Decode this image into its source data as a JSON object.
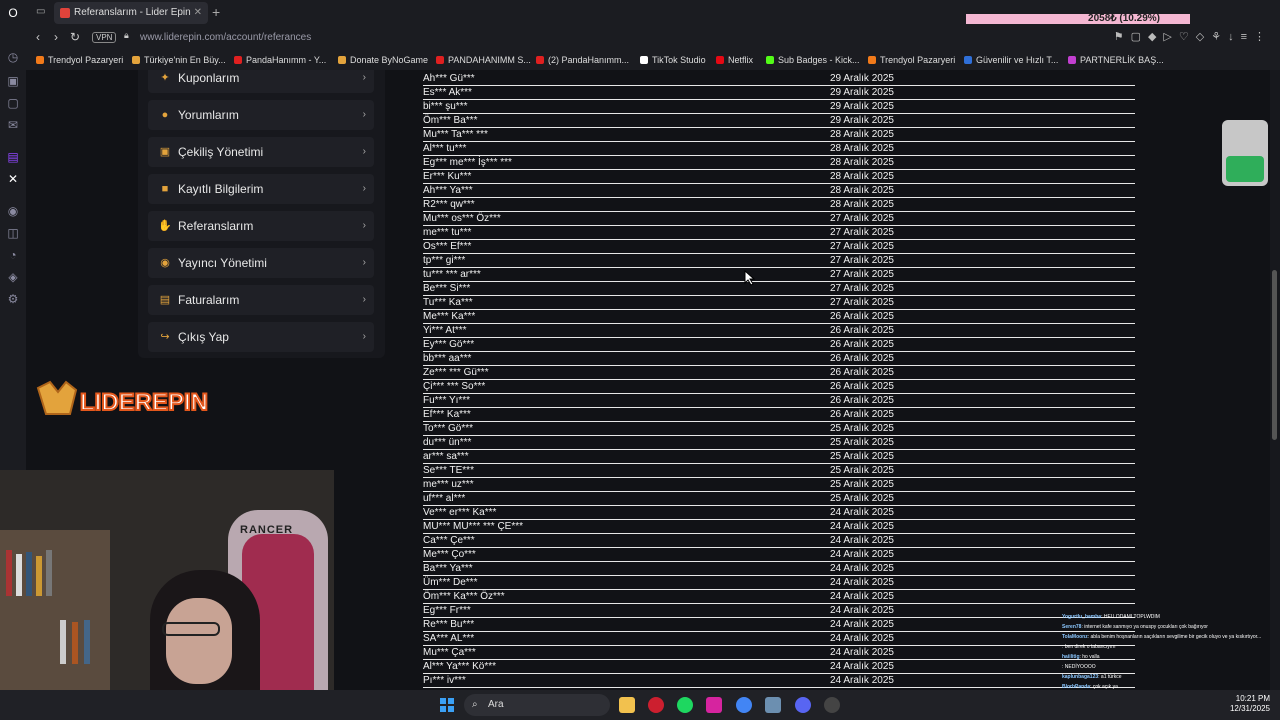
{
  "browser": {
    "tab_title": "Referanslarım - Lider Epin",
    "url": "www.liderepin.com/account/referances",
    "vpn_label": "VPN",
    "progress_text": "2058₺ (10.29%)",
    "progress_fraction": 0.1029
  },
  "bookmarks": [
    "Trendyol Pazaryeri",
    "Türkiye'nin En Büy...",
    "PandaHanımm - Y...",
    "Donate ByNoGame",
    "PANDAHANIMM S...",
    "(2) PandaHanımm...",
    "TikTok Studio",
    "Netflix",
    "Sub Badges - Kick...",
    "Trendyol Pazaryeri",
    "Güvenilir ve Hızlı T...",
    "PARTNERLİK BAŞ..."
  ],
  "sidebar": {
    "items": [
      {
        "label": "Kuponlarım",
        "icon": "ticket-icon"
      },
      {
        "label": "Yorumlarım",
        "icon": "comment-icon"
      },
      {
        "label": "Çekiliş Yönetimi",
        "icon": "gift-icon"
      },
      {
        "label": "Kayıtlı Bilgilerim",
        "icon": "save-icon"
      },
      {
        "label": "Referanslarım",
        "icon": "handshake-icon"
      },
      {
        "label": "Yayıncı Yönetimi",
        "icon": "broadcast-icon"
      },
      {
        "label": "Faturalarım",
        "icon": "invoice-icon"
      },
      {
        "label": "Çıkış Yap",
        "icon": "logout-icon"
      }
    ]
  },
  "logo": {
    "text": "LIDEREPIN"
  },
  "references": [
    {
      "name": "Ah*** Gü***",
      "date": "29 Aralık 2025"
    },
    {
      "name": "Es*** Ak***",
      "date": "29 Aralık 2025"
    },
    {
      "name": "bi*** şu***",
      "date": "29 Aralık 2025"
    },
    {
      "name": "Öm*** Ba***",
      "date": "29 Aralık 2025"
    },
    {
      "name": "Mu*** Ta*** ***",
      "date": "28 Aralık 2025"
    },
    {
      "name": "Al*** tu***",
      "date": "28 Aralık 2025"
    },
    {
      "name": "Eg*** me*** İş*** ***",
      "date": "28 Aralık 2025"
    },
    {
      "name": "Er*** Ku***",
      "date": "28 Aralık 2025"
    },
    {
      "name": "Ah*** Ya***",
      "date": "28 Aralık 2025"
    },
    {
      "name": "R2*** qw***",
      "date": "28 Aralık 2025"
    },
    {
      "name": "Mu*** os*** Öz***",
      "date": "27 Aralık 2025"
    },
    {
      "name": "me*** tu***",
      "date": "27 Aralık 2025"
    },
    {
      "name": "Os*** Ef***",
      "date": "27 Aralık 2025"
    },
    {
      "name": "tp*** gi***",
      "date": "27 Aralık 2025"
    },
    {
      "name": "tu*** *** ar***",
      "date": "27 Aralık 2025"
    },
    {
      "name": "Be*** Si***",
      "date": "27 Aralık 2025"
    },
    {
      "name": "Tu*** Ka***",
      "date": "27 Aralık 2025"
    },
    {
      "name": "Me*** Ka***",
      "date": "26 Aralık 2025"
    },
    {
      "name": "Yi*** At***",
      "date": "26 Aralık 2025"
    },
    {
      "name": "Ey*** Gö***",
      "date": "26 Aralık 2025"
    },
    {
      "name": "bb*** aa***",
      "date": "26 Aralık 2025"
    },
    {
      "name": "Ze*** *** Gü***",
      "date": "26 Aralık 2025"
    },
    {
      "name": "Çi*** *** So***",
      "date": "26 Aralık 2025"
    },
    {
      "name": "Fu*** Yı***",
      "date": "26 Aralık 2025"
    },
    {
      "name": "Ef*** Ka***",
      "date": "26 Aralık 2025"
    },
    {
      "name": "To*** Gö***",
      "date": "25 Aralık 2025"
    },
    {
      "name": "du*** ün***",
      "date": "25 Aralık 2025"
    },
    {
      "name": "ar*** sa***",
      "date": "25 Aralık 2025"
    },
    {
      "name": "Se*** TE***",
      "date": "25 Aralık 2025"
    },
    {
      "name": "me*** uz***",
      "date": "25 Aralık 2025"
    },
    {
      "name": "uf*** al***",
      "date": "25 Aralık 2025"
    },
    {
      "name": "Ve*** er*** Ka***",
      "date": "24 Aralık 2025"
    },
    {
      "name": "MU*** MU*** *** ÇE***",
      "date": "24 Aralık 2025"
    },
    {
      "name": "Ca*** Çe***",
      "date": "24 Aralık 2025"
    },
    {
      "name": "Me*** Ço***",
      "date": "24 Aralık 2025"
    },
    {
      "name": "Ba*** Ya***",
      "date": "24 Aralık 2025"
    },
    {
      "name": "Üm*** De***",
      "date": "24 Aralık 2025"
    },
    {
      "name": "Öm*** Ka*** Öz***",
      "date": "24 Aralık 2025"
    },
    {
      "name": "Eg*** Fr***",
      "date": "24 Aralık 2025"
    },
    {
      "name": "Re*** Bu***",
      "date": "24 Aralık 2025"
    },
    {
      "name": "SA*** AL***",
      "date": "24 Aralık 2025"
    },
    {
      "name": "Mu*** Ça***",
      "date": "24 Aralık 2025"
    },
    {
      "name": "Al*** Ya*** Kö***",
      "date": "24 Aralık 2025"
    },
    {
      "name": "Pı*** iv***",
      "date": "24 Aralık 2025"
    }
  ],
  "chat": [
    {
      "user": "Yogurtlu_bamba",
      "msg": "HEU ODAMI TOPLWDIM"
    },
    {
      "user": "Seren78",
      "msg": "internet kafe sanmıyo ya onuspy çocukları çok bağırıyor"
    },
    {
      "user": "TolaMoonz",
      "msg": "abla benim hoşnanların saçıkların sevgilime bir gecik oluyo ve ya kıskırtıyor..."
    },
    {
      "user": "",
      "msg": "ben direk o tabancıyım"
    },
    {
      "user": "haiilitig",
      "msg": "ho valla"
    },
    {
      "user": "",
      "msg": "NEDİYOOOO"
    },
    {
      "user": "kaplunbaga123",
      "msg": "a1 türkce"
    },
    {
      "user": "BlorbPanda",
      "msg": "çok açık ya"
    },
    {
      "user": "haiilitig",
      "msg": "yoooo keyifim beğe ne zaman kapalı demedim"
    },
    {
      "user": "",
      "msg": "2x1 abuk"
    }
  ],
  "taskbar": {
    "search_label": "Ara",
    "time": "10:21 PM",
    "date": "12/31/2025"
  },
  "colors": {
    "accent": "#e3a33c",
    "progress": "#f4b7d2",
    "page_bg": "#111216",
    "sidebar_bg": "#17181d"
  }
}
